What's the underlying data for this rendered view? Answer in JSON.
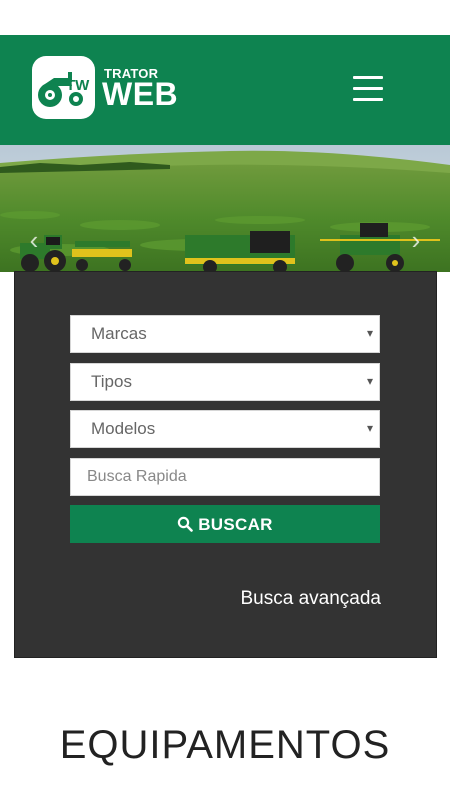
{
  "header": {
    "logo": {
      "small_text": "TRATOR",
      "big_text": "WEB",
      "mark_letters": "TW"
    },
    "menu_icon": "hamburger-menu-icon",
    "background_color": "#0e8350"
  },
  "hero": {
    "prev_icon": "chevron-left-icon",
    "next_icon": "chevron-right-icon",
    "prev_glyph": "‹",
    "next_glyph": "›"
  },
  "search": {
    "brands_select": {
      "label": "Marcas",
      "caret": "▾"
    },
    "types_select": {
      "label": "Tipos",
      "caret": "▾"
    },
    "models_select": {
      "label": "Modelos",
      "caret": "▾"
    },
    "quick_search": {
      "placeholder": "Busca Rapida",
      "value": ""
    },
    "search_button": {
      "label": "BUSCAR",
      "icon": "search-icon"
    },
    "advanced_link": "Busca avançada",
    "panel_color": "#333333",
    "accent_color": "#0e8350"
  },
  "section": {
    "title": "EQUIPAMENTOS"
  }
}
